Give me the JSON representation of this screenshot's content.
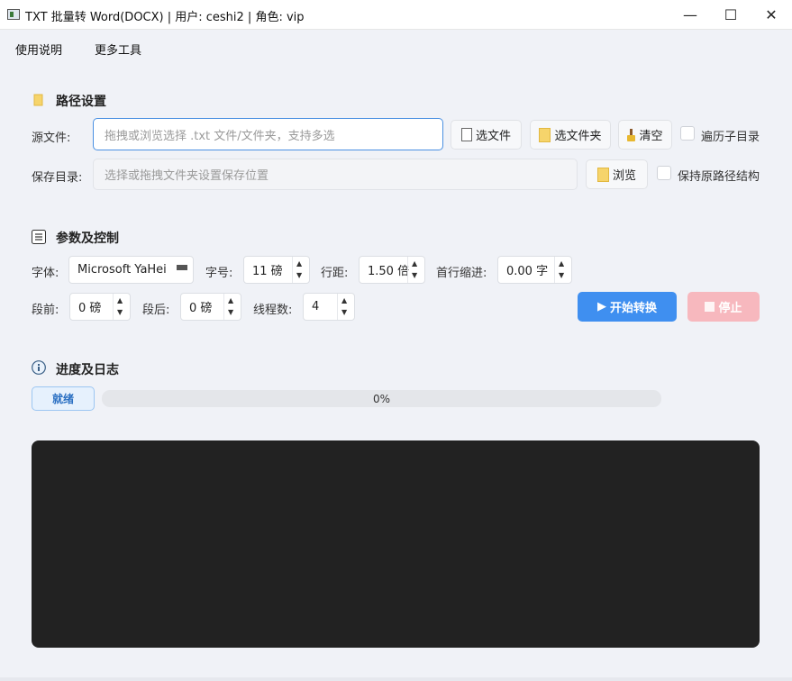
{
  "window": {
    "title": "TXT 批量转 Word(DOCX)  |  用户: ceshi2  |  角色: vip",
    "minimize_glyph": "—",
    "maximize_glyph": "☐",
    "close_glyph": "✕"
  },
  "menu": {
    "items": [
      "使用说明",
      "更多工具"
    ]
  },
  "path_section": {
    "title": "路径设置",
    "source_label": "源文件:",
    "source_placeholder": "拖拽或浏览选择 .txt 文件/文件夹，支持多选",
    "select_files_label": "选文件",
    "select_folder_label": "选文件夹",
    "clear_label": "清空",
    "recurse_label": "遍历子目录",
    "save_label": "保存目录:",
    "save_placeholder": "选择或拖拽文件夹设置保存位置",
    "browse_label": "浏览",
    "keep_structure_label": "保持原路径结构"
  },
  "params_section": {
    "title": "参数及控制",
    "font_label": "字体:",
    "font_value": "Microsoft YaHei",
    "size_label": "字号:",
    "size_value": "11 磅",
    "line_spacing_label": "行距:",
    "line_spacing_value": "1.50 倍",
    "indent_label": "首行缩进:",
    "indent_value": "0.00 字",
    "before_label": "段前:",
    "before_value": "0 磅",
    "after_label": "段后:",
    "after_value": "0 磅",
    "threads_label": "线程数:",
    "threads_value": "4",
    "start_label": "开始转换",
    "stop_label": "停止"
  },
  "progress_section": {
    "title": "进度及日志",
    "status_badge": "就绪",
    "progress_text": "0%",
    "progress_value": 0
  },
  "colors": {
    "accent": "#3f8ff0",
    "stop": "#f7b8be",
    "log_background": "#222222",
    "background": "#f0f2f7"
  }
}
